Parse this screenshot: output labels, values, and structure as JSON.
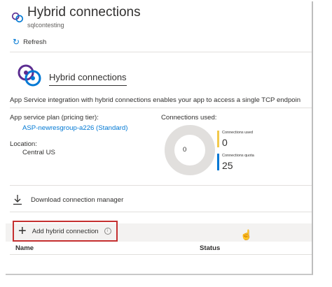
{
  "header": {
    "title": "Hybrid connections",
    "subtitle": "sqlcontesting"
  },
  "toolbar": {
    "refresh_label": "Refresh"
  },
  "section": {
    "title": "Hybrid connections",
    "description": "App Service integration with hybrid connections enables your app to access a single TCP endpoin"
  },
  "plan": {
    "label": "App service plan (pricing tier):",
    "value": "ASP-newresgroup-a226 (Standard)"
  },
  "location": {
    "label": "Location:",
    "value": "Central US"
  },
  "connections": {
    "label": "Connections used:",
    "used": 0,
    "center_value": "0",
    "legend": [
      {
        "label": "Connections used",
        "value": "0",
        "color": "#f2c94c"
      },
      {
        "label": "Connections quota",
        "value": "25",
        "color": "#0078d4"
      }
    ]
  },
  "download": {
    "label": "Download connection manager"
  },
  "add": {
    "label": "Add hybrid connection",
    "info_icon": "i"
  },
  "table": {
    "columns": [
      "Name",
      "Status"
    ]
  }
}
